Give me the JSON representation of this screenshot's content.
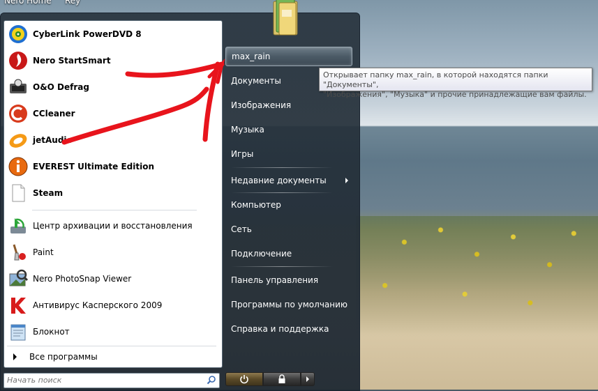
{
  "desktop": {
    "top_labels": [
      "Nero Home",
      "Rey"
    ]
  },
  "start_menu": {
    "pinned": [
      {
        "label": "CyberLink PowerDVD 8",
        "icon": "powerdvd-icon"
      },
      {
        "label": "Nero StartSmart",
        "icon": "nero-icon"
      },
      {
        "label": "O&O Defrag",
        "icon": "defrag-icon"
      },
      {
        "label": "CCleaner",
        "icon": "ccleaner-icon"
      },
      {
        "label": "jetAudio",
        "icon": "jetaudio-icon"
      },
      {
        "label": "EVEREST Ultimate Edition",
        "icon": "everest-icon"
      },
      {
        "label": "Steam",
        "icon": "document-icon"
      }
    ],
    "recent": [
      {
        "label": "Центр архивации и восстановления",
        "icon": "backup-icon"
      },
      {
        "label": "Paint",
        "icon": "paint-icon"
      },
      {
        "label": "Nero PhotoSnap Viewer",
        "icon": "photosnap-icon"
      },
      {
        "label": "Антивирус Касперского 2009",
        "icon": "kaspersky-icon"
      },
      {
        "label": "Блокнот",
        "icon": "notepad-icon"
      }
    ],
    "all_programs": "Все программы",
    "search_placeholder": "Начать поиск",
    "right": {
      "user": "max_rain",
      "group1": [
        "Документы",
        "Изображения",
        "Музыка",
        "Игры"
      ],
      "recent_docs": "Недавние документы",
      "group2": [
        "Компьютер",
        "Сеть",
        "Подключение"
      ],
      "group3": [
        "Панель управления",
        "Программы по умолчанию",
        "Справка и поддержка"
      ]
    },
    "tooltip": {
      "line1": "Открывает папку max_rain, в которой находятся папки \"Документы\",",
      "line2": "\"Изображения\", \"Музыка\" и прочие принадлежащие вам файлы."
    }
  },
  "colors": {
    "annotation_red": "#e8141c",
    "menu_dark": "#2c3a46"
  }
}
